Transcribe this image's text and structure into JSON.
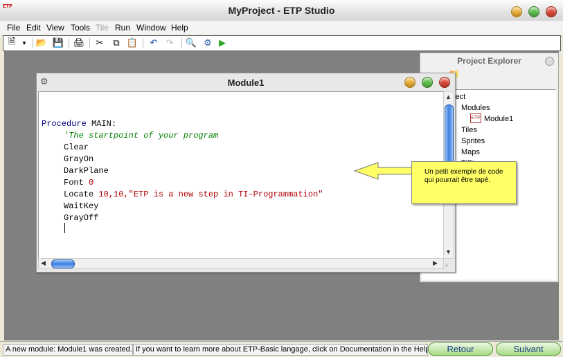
{
  "window": {
    "title": "MyProject - ETP Studio",
    "logo_text": "ETP"
  },
  "menu": [
    "File",
    "Edit",
    "View",
    "Tools",
    "Tile",
    "Run",
    "Window",
    "Help"
  ],
  "toolbar": {
    "icons": [
      "new-file-icon",
      "dropdown-arrow-icon",
      "open-folder-icon",
      "save-icon",
      "print-icon",
      "cut-icon",
      "copy-icon",
      "paste-icon",
      "undo-icon",
      "redo-icon",
      "find-icon",
      "compile-icon",
      "run-icon"
    ]
  },
  "explorer": {
    "title": "Project Explorer",
    "items": [
      "oject",
      "Modules",
      "Module1",
      "Tiles",
      "Sprites",
      "Maps",
      "TiBi"
    ]
  },
  "module": {
    "title": "Module1",
    "code": {
      "proc_keyword": "Procedure",
      "proc_name": " MAIN:",
      "comment": "'The startpoint of your program",
      "clear": "Clear",
      "grayon": "GrayOn",
      "darkplane": "DarkPlane",
      "font_kw": "Font ",
      "font_num": "0",
      "locate_kw": "Locate ",
      "locate_num": "10,10,",
      "locate_str": "\"ETP is a new step in TI-Programmation\"",
      "waitkey": "WaitKey",
      "grayoff": "GrayOff"
    }
  },
  "callout": {
    "text": "Un petit exemple de code qui pourrait être tapé."
  },
  "status": {
    "left": "A new module: Module1 was created.",
    "right": "If you want to learn more about ETP-Basic langage, click on Documentation in the Help m"
  },
  "nav": {
    "back": "Retour",
    "next": "Suivant"
  },
  "colors": {
    "keyword": "#000080",
    "comment": "#008000",
    "string": "#b00000",
    "callout": "#ffff66",
    "nav_text": "#1a3d8a"
  }
}
